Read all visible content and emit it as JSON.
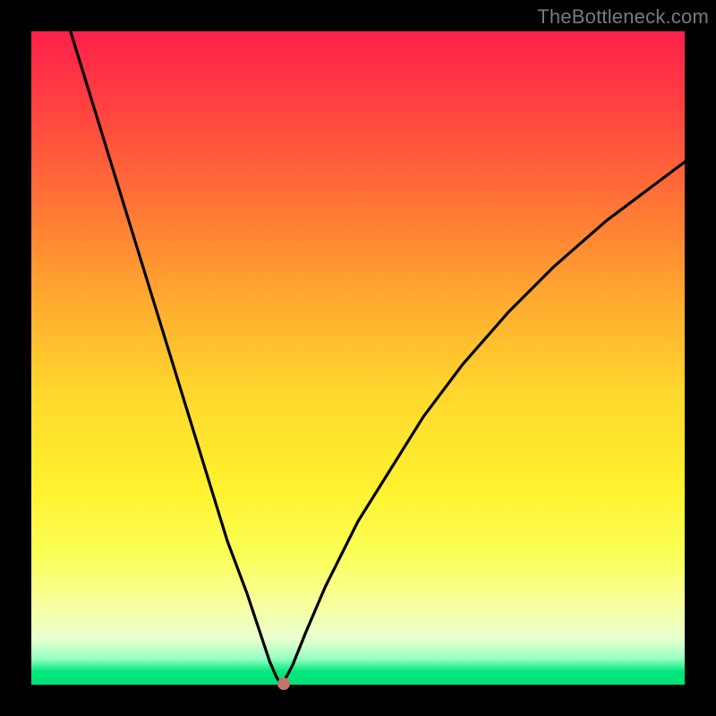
{
  "watermark": "TheBottleneck.com",
  "colors": {
    "frame": "#000000",
    "curve": "#000000",
    "marker": "#c2756a",
    "gradient_top": "#ff1f4a",
    "gradient_bottom": "#00e07a"
  },
  "chart_data": {
    "type": "line",
    "title": "",
    "xlabel": "",
    "ylabel": "",
    "xlim": [
      0,
      100
    ],
    "ylim": [
      0,
      100
    ],
    "grid": false,
    "legend": false,
    "series": [
      {
        "name": "curve",
        "x": [
          6,
          10,
          14,
          18,
          22,
          26,
          30,
          33,
          35,
          36.5,
          37.5,
          38,
          38.3,
          38.6,
          40,
          42,
          45,
          50,
          55,
          60,
          66,
          73,
          80,
          88,
          96,
          100
        ],
        "y": [
          100,
          87,
          74,
          61,
          48,
          35,
          22,
          14,
          8,
          3.5,
          1.2,
          0.4,
          0.1,
          0.4,
          3,
          8,
          15,
          25,
          33,
          41,
          49,
          57,
          64,
          71,
          77,
          80
        ]
      }
    ],
    "marker": {
      "x": 38.6,
      "y": 0.2
    },
    "notes": "Axes have no tick labels in the image; values are normalized 0–100 estimates read from pixel positions."
  }
}
